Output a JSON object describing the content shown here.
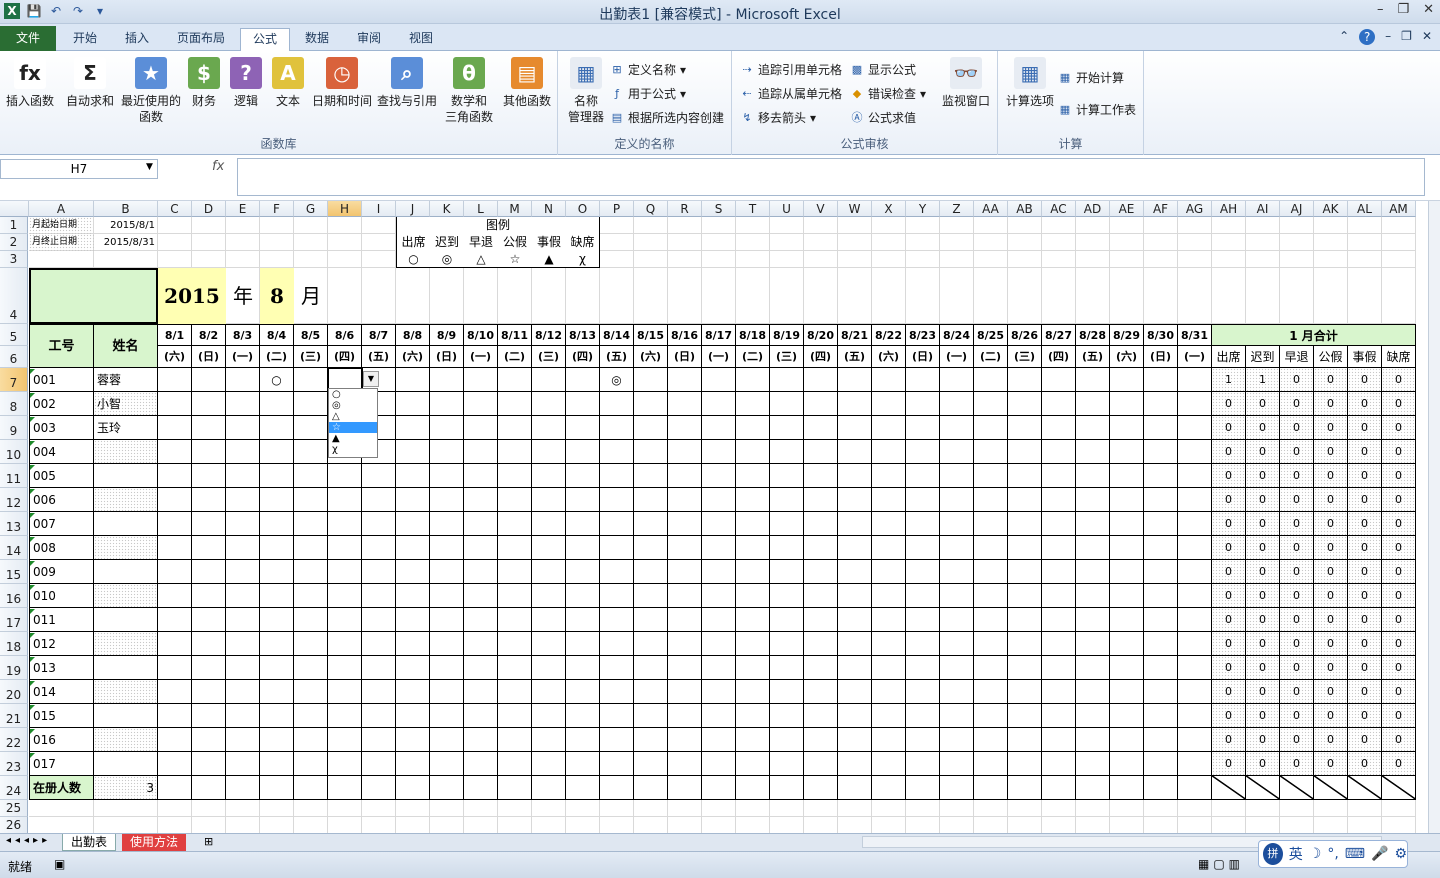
{
  "window": {
    "title": "出勤表1  [兼容模式] - Microsoft Excel"
  },
  "qat": {
    "save": "💾",
    "undo": "↶",
    "redo": "↷",
    "more": "▾"
  },
  "ribbon_tabs": [
    "文件",
    "开始",
    "插入",
    "页面布局",
    "公式",
    "数据",
    "审阅",
    "视图"
  ],
  "active_tab": "公式",
  "ribbon": {
    "library": {
      "label": "函数库",
      "buttons": [
        {
          "icon": "fx",
          "text": "插入函数"
        },
        {
          "icon": "Σ",
          "text": "自动求和"
        },
        {
          "icon": "★",
          "text": "最近使用的\n函数"
        },
        {
          "icon": "$",
          "text": "财务"
        },
        {
          "icon": "?",
          "text": "逻辑"
        },
        {
          "icon": "A",
          "text": "文本"
        },
        {
          "icon": "◷",
          "text": "日期和时间"
        },
        {
          "icon": "⌕",
          "text": "查找与引用"
        },
        {
          "icon": "θ",
          "text": "数学和\n三角函数"
        },
        {
          "icon": "▤",
          "text": "其他函数"
        }
      ]
    },
    "names": {
      "label": "定义的名称",
      "big": "名称\n管理器",
      "small": [
        "定义名称",
        "用于公式",
        "根据所选内容创建"
      ]
    },
    "audit": {
      "label": "公式审核",
      "small": [
        "追踪引用单元格",
        "追踪从属单元格",
        "移去箭头",
        "显示公式",
        "错误检查",
        "公式求值"
      ],
      "watch": "监视窗口"
    },
    "calc": {
      "label": "计算",
      "options": "计算选项",
      "small": [
        "开始计算",
        "计算工作表"
      ]
    }
  },
  "formula_bar": {
    "name_box": "H7",
    "fx": "fx",
    "value": ""
  },
  "columns": [
    "A",
    "B",
    "C",
    "D",
    "E",
    "F",
    "G",
    "H",
    "I",
    "J",
    "K",
    "L",
    "M",
    "N",
    "O",
    "P",
    "Q",
    "R",
    "S",
    "T",
    "U",
    "V",
    "W",
    "X",
    "Y",
    "Z",
    "AA",
    "AB",
    "AC",
    "AD",
    "AE",
    "AF",
    "AG",
    "AH",
    "AI",
    "AJ",
    "AK",
    "AL",
    "AM"
  ],
  "rows": [
    "1",
    "2",
    "3",
    "4",
    "5",
    "6",
    "7",
    "8",
    "9",
    "10",
    "11",
    "12",
    "13",
    "14",
    "15",
    "16",
    "17",
    "18",
    "19",
    "20",
    "21",
    "22",
    "23",
    "24",
    "25",
    "26"
  ],
  "sheet": {
    "start_label": "月起始日期",
    "start_value": "2015/8/1",
    "end_label": "月终止日期",
    "end_value": "2015/8/31",
    "legend_title": "图例",
    "legend": [
      {
        "name": "出席",
        "symbol": "○"
      },
      {
        "name": "迟到",
        "symbol": "◎"
      },
      {
        "name": "早退",
        "symbol": "△"
      },
      {
        "name": "公假",
        "symbol": "☆"
      },
      {
        "name": "事假",
        "symbol": "▲"
      },
      {
        "name": "缺席",
        "symbol": "χ"
      }
    ],
    "year": "2015",
    "year_unit": "年",
    "month": "8",
    "month_unit": "月",
    "hdr_id": "工号",
    "hdr_name": "姓名",
    "dates": [
      "8/1",
      "8/2",
      "8/3",
      "8/4",
      "8/5",
      "8/6",
      "8/7",
      "8/8",
      "8/9",
      "8/10",
      "8/11",
      "8/12",
      "8/13",
      "8/14",
      "8/15",
      "8/16",
      "8/17",
      "8/18",
      "8/19",
      "8/20",
      "8/21",
      "8/22",
      "8/23",
      "8/24",
      "8/25",
      "8/26",
      "8/27",
      "8/28",
      "8/29",
      "8/30",
      "8/31"
    ],
    "weekdays": [
      "(六)",
      "(日)",
      "(一)",
      "(二)",
      "(三)",
      "(四)",
      "(五)",
      "(六)",
      "(日)",
      "(一)",
      "(二)",
      "(三)",
      "(四)",
      "(五)",
      "(六)",
      "(日)",
      "(一)",
      "(二)",
      "(三)",
      "(四)",
      "(五)",
      "(六)",
      "(日)",
      "(一)",
      "(二)",
      "(三)",
      "(四)",
      "(五)",
      "(六)",
      "(日)",
      "(一)"
    ],
    "summary_title": "1  月合计",
    "summary_cols": [
      "出席",
      "迟到",
      "早退",
      "公假",
      "事假",
      "缺席"
    ],
    "employees": [
      {
        "id": "001",
        "name": "蓉蓉",
        "marks": {
          "3": "○",
          "13": "◎"
        },
        "totals": [
          "1",
          "1",
          "0",
          "0",
          "0",
          "0"
        ]
      },
      {
        "id": "002",
        "name": "小智",
        "marks": {},
        "totals": [
          "0",
          "0",
          "0",
          "0",
          "0",
          "0"
        ]
      },
      {
        "id": "003",
        "name": "玉玲",
        "marks": {},
        "totals": [
          "0",
          "0",
          "0",
          "0",
          "0",
          "0"
        ]
      },
      {
        "id": "004",
        "name": "",
        "marks": {},
        "totals": [
          "0",
          "0",
          "0",
          "0",
          "0",
          "0"
        ]
      },
      {
        "id": "005",
        "name": "",
        "marks": {},
        "totals": [
          "0",
          "0",
          "0",
          "0",
          "0",
          "0"
        ]
      },
      {
        "id": "006",
        "name": "",
        "marks": {},
        "totals": [
          "0",
          "0",
          "0",
          "0",
          "0",
          "0"
        ]
      },
      {
        "id": "007",
        "name": "",
        "marks": {},
        "totals": [
          "0",
          "0",
          "0",
          "0",
          "0",
          "0"
        ]
      },
      {
        "id": "008",
        "name": "",
        "marks": {},
        "totals": [
          "0",
          "0",
          "0",
          "0",
          "0",
          "0"
        ]
      },
      {
        "id": "009",
        "name": "",
        "marks": {},
        "totals": [
          "0",
          "0",
          "0",
          "0",
          "0",
          "0"
        ]
      },
      {
        "id": "010",
        "name": "",
        "marks": {},
        "totals": [
          "0",
          "0",
          "0",
          "0",
          "0",
          "0"
        ]
      },
      {
        "id": "011",
        "name": "",
        "marks": {},
        "totals": [
          "0",
          "0",
          "0",
          "0",
          "0",
          "0"
        ]
      },
      {
        "id": "012",
        "name": "",
        "marks": {},
        "totals": [
          "0",
          "0",
          "0",
          "0",
          "0",
          "0"
        ]
      },
      {
        "id": "013",
        "name": "",
        "marks": {},
        "totals": [
          "0",
          "0",
          "0",
          "0",
          "0",
          "0"
        ]
      },
      {
        "id": "014",
        "name": "",
        "marks": {},
        "totals": [
          "0",
          "0",
          "0",
          "0",
          "0",
          "0"
        ]
      },
      {
        "id": "015",
        "name": "",
        "marks": {},
        "totals": [
          "0",
          "0",
          "0",
          "0",
          "0",
          "0"
        ]
      },
      {
        "id": "016",
        "name": "",
        "marks": {},
        "totals": [
          "0",
          "0",
          "0",
          "0",
          "0",
          "0"
        ]
      },
      {
        "id": "017",
        "name": "",
        "marks": {},
        "totals": [
          "0",
          "0",
          "0",
          "0",
          "0",
          "0"
        ]
      }
    ],
    "count_label": "在册人数",
    "count_value": "3",
    "dropdown_options": [
      "○",
      "◎",
      "△",
      "☆",
      "▲",
      "χ"
    ],
    "dropdown_selected": "☆"
  },
  "sheet_tabs": [
    "出勤表",
    "使用方法"
  ],
  "status": {
    "ready": "就绪"
  },
  "ime": {
    "lang": "英",
    "items": [
      "☽",
      "°,",
      "⌨",
      "🎤",
      "⚙"
    ]
  }
}
